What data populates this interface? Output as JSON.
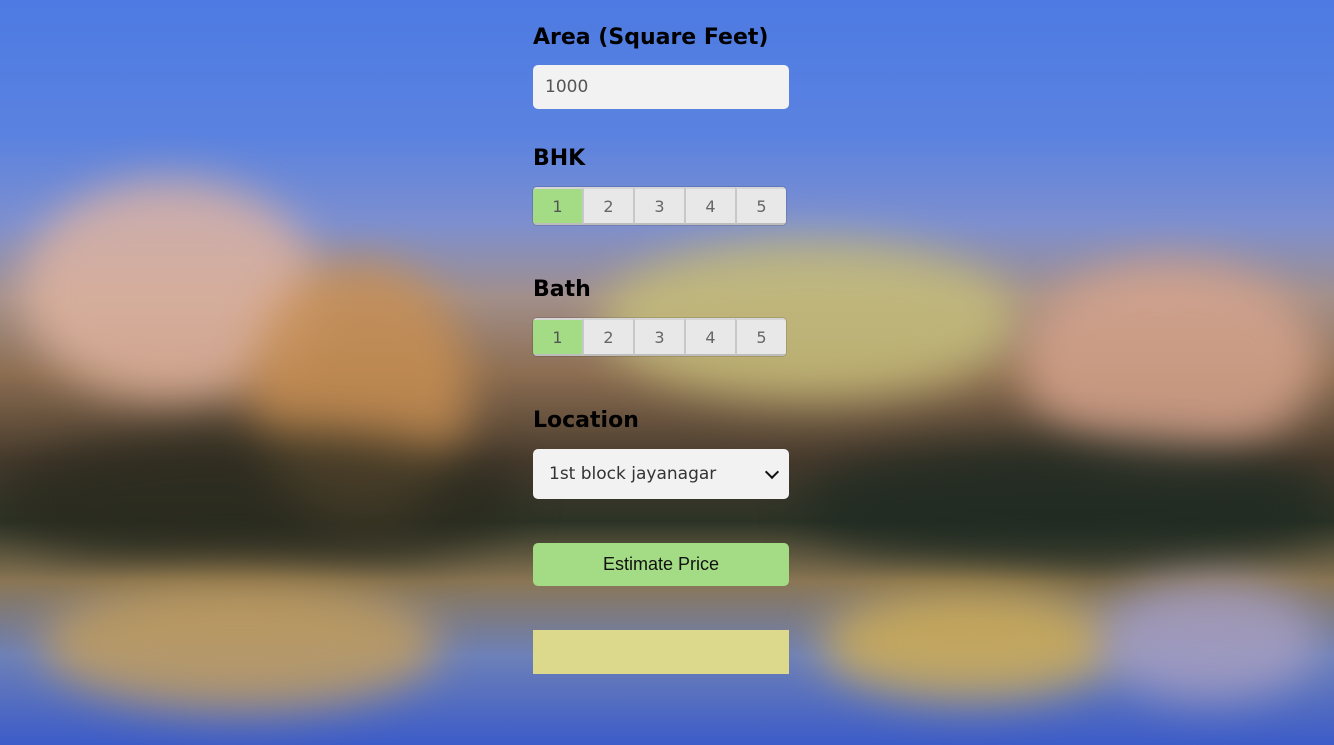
{
  "area": {
    "label": "Area (Square Feet)",
    "value": "1000"
  },
  "bhk": {
    "label": "BHK",
    "options": [
      "1",
      "2",
      "3",
      "4",
      "5"
    ],
    "selected": "1"
  },
  "bath": {
    "label": "Bath",
    "options": [
      "1",
      "2",
      "3",
      "4",
      "5"
    ],
    "selected": "1"
  },
  "location": {
    "label": "Location",
    "selected": "1st block jayanagar"
  },
  "estimate_button": {
    "label": "Estimate Price"
  },
  "result": {
    "text": ""
  },
  "colors": {
    "accent_green": "#a3dc85",
    "result_yellow": "#ddd98c",
    "input_bg": "#f2f2f2",
    "segment_bg": "#e8e8e8"
  }
}
